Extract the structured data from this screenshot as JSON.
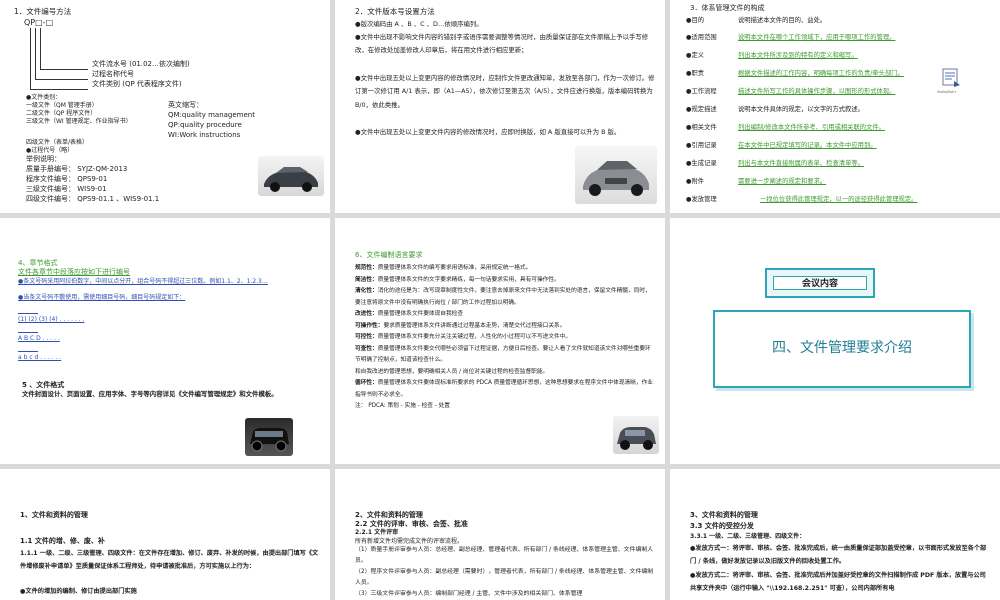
{
  "s1": {
    "heading": "1．文件编号方法",
    "code": "QP□-□",
    "f1": "文件流水号 (01.02…依次编制)",
    "f2": "过程名称代号",
    "f3": "文件类别 (QP 代表程序文件)",
    "types_head": "●文件类别：",
    "types": [
      "一级文件（QM 管理手册）",
      "二级文件（QP 程序文件）",
      "三级文件（WI 管理规定、作业指导书）"
    ],
    "abbr_head": "英文缩写：",
    "abbr": [
      "QM:quality management",
      "QP:quality procedure",
      "WI:Work instructions"
    ],
    "types4": "四级文件（表单/表格）",
    "proc_code": "●过程代号（略）",
    "example_head": "举例说明：",
    "examples": [
      "质量手册编号：  SYJZ-QM-2013",
      "程序文件编号：  QPS9-01",
      "三级文件编号：  WIS9-01",
      "四级文件编号：  QPS9-01.1 、WIS9-01.1"
    ]
  },
  "s2": {
    "heading": "2．文件版本号设置方法",
    "p1": "●版次编码由 A 、B 、C 、D…依顺序编列。",
    "p2": "●文件中出现不影响文件内容的错别字或语序需要调整等情况时，由质量保证部在文件原稿上予以手写修改，在修改处加盖修改人印章后，将在用文件进行相应更新；",
    "p3": "●文件中出现五处以上变更内容的修改情况时，应制作文件更改通知单，发放至各部门，作为一次修订。修订第一次修订用 A/1 表示，即（A1—A5），依次修订至第五次（A/5），文件应进行换版，版本编码转换为 B/0，依此类推。",
    "p4": "●文件中出现五处以上变更文件内容的修改情况时，应即时换版，如 A 版直接可以升为 B 版。"
  },
  "s3": {
    "heading": "3．体系管理文件的构成",
    "items": [
      {
        "k": "●目的",
        "v": "说明描述本文件的目的、益处。"
      },
      {
        "k": "●适用范围",
        "v": "说明本文件在哪个工作领域下，应用于哪项工作的管理。"
      },
      {
        "k": "●定义",
        "v": "列出本文件所涉及到的特有的定义和缩写。"
      },
      {
        "k": "●职责",
        "v": "根据文件描述的工作内容，明确每项工作的负责/牵头部门。"
      },
      {
        "k": "●工作流程",
        "v": "描述文件所写工作的具体操作步骤，以图形的形式体现。"
      },
      {
        "k": "●规定描述",
        "v": "说明本文件具体的规定，以文字的方式叙述。"
      },
      {
        "k": "●相关文件",
        "v": "列出编制/修改本文件所参考、引用或相关联的文件。"
      },
      {
        "k": "●引用记录",
        "v": "在本文件中已规定填写的记录。本文件中应用到。"
      },
      {
        "k": "●生成记录",
        "v": "列出与本文件直接附属的表单、检查清单等。"
      },
      {
        "k": "●附件",
        "v": "需要进一步阐述的规定和要求。"
      },
      {
        "k": "●发放管理",
        "v": "一找位位获得此管理规定，以一的途径获得此管理规定。"
      }
    ],
    "icon_label": "VisibyBuk+"
  },
  "s4": {
    "h1": "4、章节格式",
    "l1": "文件各章节中段落应按如下进行编号",
    "l2": "●条文号码采用阿拉伯数字，中间以点分开，组合号码不得超过三位数。例如1.1、2、1.2.3…",
    "l3": "●当条文号码不敷使用，需使用细目号码，细目号码规定如下：",
    "l4": "(1)  (2)  (3)  (4)   . . . . . . .",
    "l5": "A    B    C    D      . . . . .",
    "l6": "a    b    c    d    . . . . . .",
    "h2": "5 、文件格式",
    "p1": "文件封面设计、页面设置、应用字体、字号等内容详见《文件编写管理规定》和文件模板。"
  },
  "s5": {
    "heading": "6、文件编制语言要求",
    "items": [
      {
        "k": "规范性：",
        "v": "质量管理体系文件的编写要求用语标准，采用规定统一格式。"
      },
      {
        "k": "简洁性：",
        "v": "质量管理体系文件的文字要求精练，每一句话要求实用，具有可操作性。"
      },
      {
        "k": "清化性：",
        "v": "消化的途径是为：改写现章制度性文件，要注意去掉原来文件中无法落到实处的语言，保留文件精髓，同时，要注意将原文件中没有明确执行岗位 / 部门的工作过程加以明确。"
      },
      {
        "k": "改进性：",
        "v": "质量管理体系文件要体现自我检查"
      },
      {
        "k": "可操作性：",
        "v": "要求质量管理体系文件讲断通过过程基本走势，清楚交代过程接口关系。"
      },
      {
        "k": "可控性：",
        "v": "质量管理体系文件要充分关注关键过程，人性化的小过程可以不写进文件中。"
      },
      {
        "k": "可查性：",
        "v": "质量管理体系文件要交代哪些必须留下过程证据，方便日后检查。要让人看了文件就知道该文件对哪些重要环节明确了控制点，知道该检查什么。"
      },
      {
        "k": "",
        "v": "和自我改进的管理思想，要明确相关人员 / 岗位对关键过程的检查监督职能。"
      },
      {
        "k": "循环性：",
        "v": "质量管理体系文件要体现标准所要求的 PDCA 质量管理循环思想，这种思想要求在程序文件中体现清晰，作业指导书则不必求全。"
      },
      {
        "k": "注：",
        "v": "PDCA: 策划 - 实施 - 检查 - 处置"
      }
    ]
  },
  "s6": {
    "tag": "会议内容",
    "title": "四、文件管理要求介绍"
  },
  "s7": {
    "heading": "1、文件和资料的管理",
    "sub": "1.1 文件的增、修、废、补",
    "p1": "1.1.1 一级、二级、三级管理、四级文件：在文件存在增加、修订、废弃、补发的时候，由提出部门填写《文件增修废补申请单》至质量保证体系工程师处，待申请被批准后，方可实施以上行为：",
    "p2": "●文件的增加的编制、修订由提出部门实施"
  },
  "s8": {
    "heading": "2、文件和资料的管理",
    "sub": "2.2  文件的评审、审核、会签、批准",
    "sub2": "2.2.1 文件评审",
    "p0": "所有新增文件均需完成文件的评审流程。",
    "p1": "（1）质量手册评审参与人员：总经理、副总经理、管理者代表、所有部门 / 条线经理、体系管理主管、文件编制人员。",
    "p2": "（2）程序文件评审参与人员：副总经理（需要时），管理者代表，所有部门 / 条线经理、体系管理主管、文件编制人员。",
    "p3": "（3）三级文件评审参与人员：编制部门经理 / 主管、文件中涉及的相关部门、体系管理"
  },
  "s9": {
    "heading": "3、文件和资料的管理",
    "sub": "3.3  文件的受控分发",
    "sub2": "3.3.1 一级、二级、三级管理、四级文件：",
    "p1": "●发放方式一：将评审、审核、会签、批准完成后，统一由质量保证部加盖受控章，以书面形式发放至各个部门 / 条线，做好发放记录以及旧版文件的回收处置工作。",
    "p2": "●发放方式二：将评审、审核、会签、批准完成后并加盖好受控章的文件扫描制作成 PDF 版本，放置与公司共享文件夹中（运行中输入 \"\\\\192.168.2.251\" 可查），公司内部所有电"
  },
  "colors": {
    "accent_green": "#3d9a2e",
    "link_blue": "#2f4fb4",
    "teal_border": "#2aa6b8",
    "tag_bg": "#e9f6f8"
  }
}
